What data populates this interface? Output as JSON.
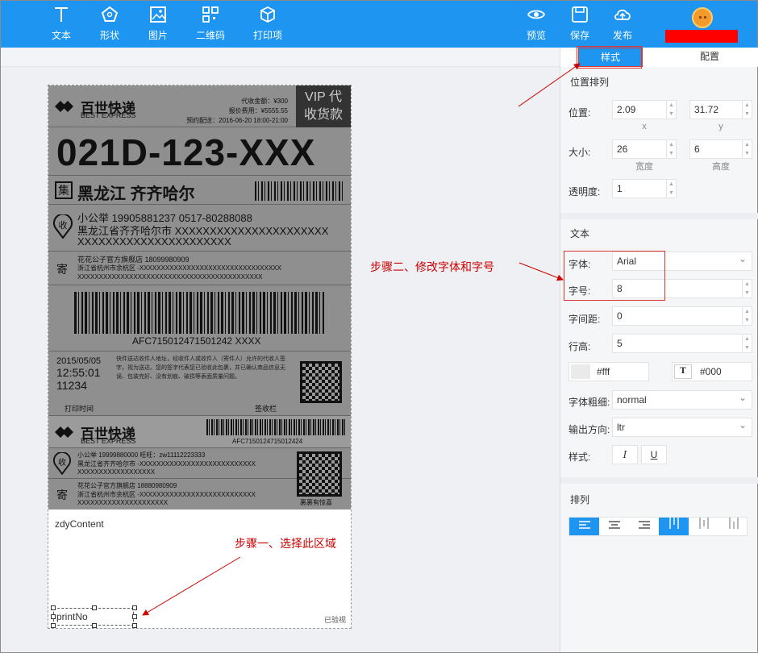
{
  "toolbar": {
    "left": [
      {
        "label": "文本",
        "icon": "text-icon"
      },
      {
        "label": "形状",
        "icon": "pentagon-icon"
      },
      {
        "label": "图片",
        "icon": "image-icon"
      },
      {
        "label": "二维码",
        "icon": "qrcode-icon"
      },
      {
        "label": "打印项",
        "icon": "cube-icon"
      }
    ],
    "right": [
      {
        "label": "预览",
        "icon": "eye-icon"
      },
      {
        "label": "保存",
        "icon": "save-icon"
      },
      {
        "label": "发布",
        "icon": "upload-cloud-icon"
      }
    ]
  },
  "panel": {
    "tabs": {
      "style": "样式",
      "config": "配置"
    },
    "position_section": {
      "title": "位置排列",
      "position_label": "位置:",
      "x_value": "2.09",
      "x_sub": "x",
      "y_value": "31.72",
      "y_sub": "y",
      "size_label": "大小:",
      "width_value": "26",
      "width_sub": "宽度",
      "height_value": "6",
      "height_sub": "高度",
      "opacity_label": "透明度:",
      "opacity_value": "1"
    },
    "text_section": {
      "title": "文本",
      "font_label": "字体:",
      "font_value": "Arial",
      "size_label": "字号:",
      "size_value": "8",
      "spacing_label": "字间距:",
      "spacing_value": "0",
      "line_height_label": "行高:",
      "line_height_value": "5",
      "bg_color": "#fff",
      "text_color_icon": "T",
      "text_color": "#000",
      "weight_label": "字体粗细:",
      "weight_value": "normal",
      "direction_label": "输出方向:",
      "direction_value": "ltr",
      "style_label": "样式:",
      "italic": "I",
      "underline": "U"
    },
    "align_section": {
      "title": "排列"
    }
  },
  "label": {
    "logo_cn": "百世快递",
    "logo_en": "BEST EXPRESS",
    "fee1": "代收金额：¥300",
    "fee2": "报价费用：¥5555.55",
    "fee3": "预约配送：2016-06-20 18:00-21:00",
    "vip1": "VIP 代",
    "vip2": "收货款",
    "code": "021D-123-XXX",
    "ji": "集",
    "city": "黑龙江 齐齐哈尔",
    "shou": "收",
    "receiver": "小公举  19905881237  0517-80288088",
    "addr1": "黑龙江省齐齐哈尔市 XXXXXXXXXXXXXXXXXXXXXX",
    "addr2": "XXXXXXXXXXXXXXXXXXXXXX",
    "ji2": "寄",
    "sender": "花花公子官方旗舰店  18099980909",
    "saddr1": "浙江省杭州市余杭区 -XXXXXXXXXXXXXXXXXXXXXXXXXXXXXXXXX",
    "saddr2": "XXXXXXXXXXXXXXXXXXXXXXXXXXXXXXXXXXXXXXXXXXX",
    "barcode_no": "AFC715012471501242 XXXX",
    "date": "2015/05/05",
    "time": "12:55:01",
    "num": "11234",
    "notice": "快件送达收件人地址，经收件人或收件人（寄件人）允许的代收人签字，视为送达。您的签字代表您已验收此包裹，并已确认商品信息无误、包装完好、没有划痕、破损等表面质量问题。",
    "print_time": "打印时间",
    "sign": "签收栏",
    "barcode_no2": "AFC7150124715012424",
    "r2": "小公举  19999880000  旺旺：zw11112223333",
    "r2a": "黑龙江省齐齐哈尔市 -XXXXXXXXXXXXXXXXXXXXXXXXXXX",
    "r2b": "XXXXXXXXXXXXXXXXXX",
    "s2": "花花公子官方旗舰店  18880980909",
    "s2a": "浙江省杭州市余杭区 -XXXXXXXXXXXXXXXXXXXXXXXXXXX",
    "s2b": "XXXXXXXXXXXXXXXXXXXXX",
    "surprise": "裹裹有惊喜",
    "custom": "zdyContent",
    "print_no": "printNo",
    "verified": "已验视"
  },
  "annotations": {
    "step1": "步骤一、选择此区域",
    "step2": "步骤二、修改字体和字号"
  }
}
